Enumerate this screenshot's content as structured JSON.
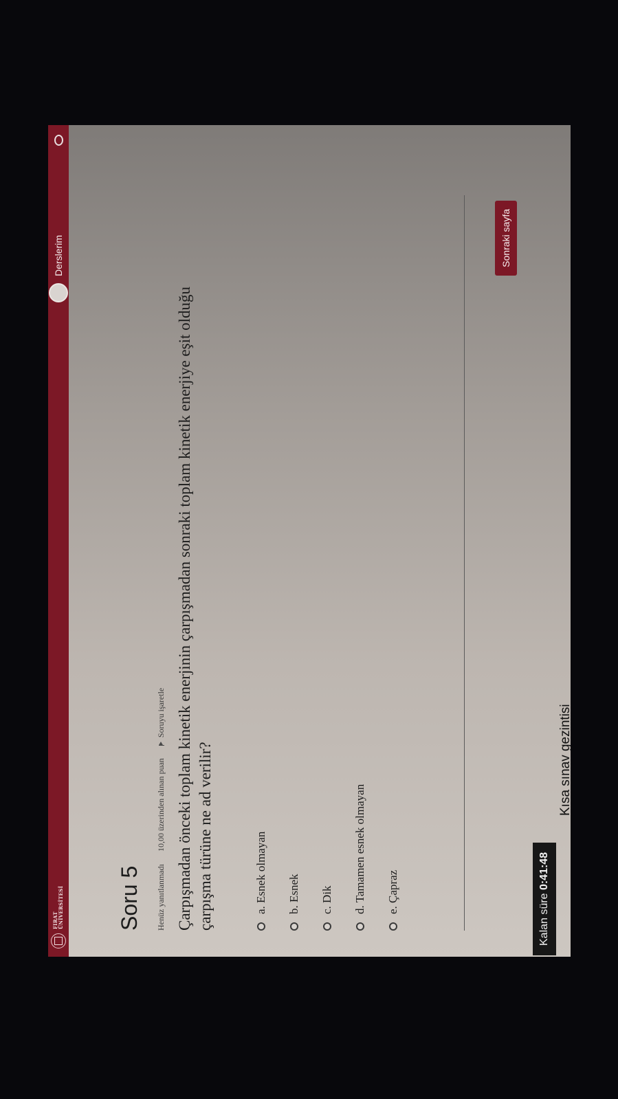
{
  "navbar": {
    "logo_line1": "FIRAT",
    "logo_line2": "ÜNİVERSİTESİ",
    "courses_label": "Derslerim"
  },
  "question": {
    "title": "Soru 5",
    "status": "Henüz yanıtlanmadı",
    "points": "10,00 üzerinden alınan puan",
    "flag_label": "Soruyu işaretle",
    "text": "Çarpışmadan önceki toplam kinetik enerjinin çarpışmadan sonraki toplam kinetik enerjiye eşit olduğu çarpışma türüne ne ad verilir?"
  },
  "answers": [
    "a. Esnek olmayan",
    "b. Esnek",
    "c. Dik",
    "d. Tamamen esnek olmayan",
    "e. Çapraz"
  ],
  "next_button": "Sonraki sayfa",
  "timer": {
    "label": "Kalan süre",
    "value": "0:41:48"
  },
  "exam_navigation": "Kısa sınav gezintisi",
  "colors": {
    "brand": "#7c1826"
  }
}
